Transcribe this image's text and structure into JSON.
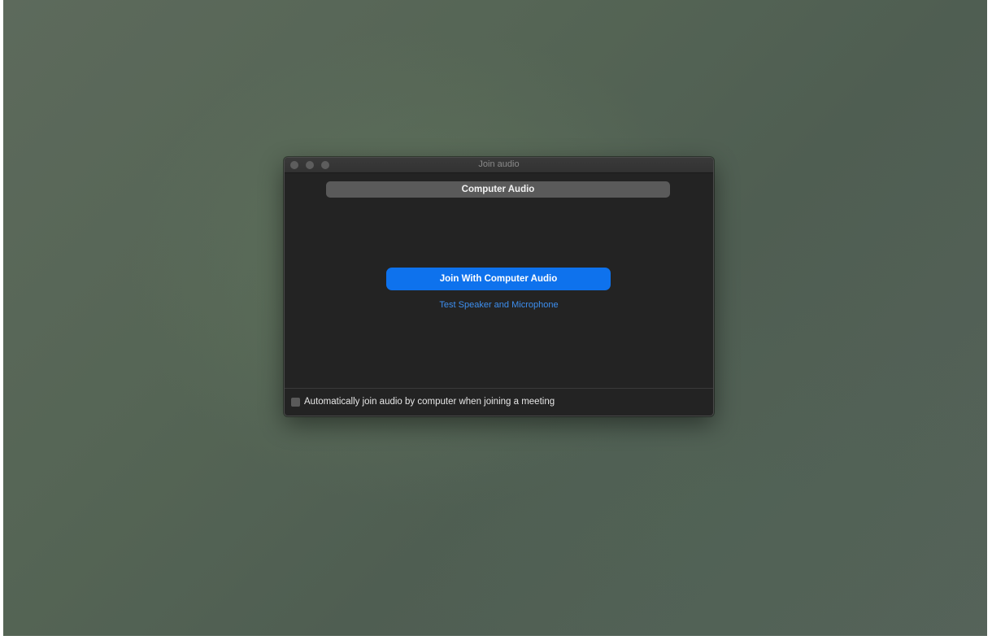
{
  "window": {
    "title": "Join audio"
  },
  "tabs": {
    "selected": "Computer Audio"
  },
  "main": {
    "join_button_label": "Join With Computer Audio",
    "test_link_label": "Test Speaker and Microphone"
  },
  "footer": {
    "auto_join_label": "Automatically join audio by computer when joining a meeting",
    "auto_join_checked": false
  },
  "colors": {
    "accent": "#0e72ed",
    "link": "#3d8ff0",
    "window_bg": "#232323"
  },
  "icons": {
    "close": "close-icon",
    "minimize": "minimize-icon",
    "maximize": "maximize-icon"
  }
}
